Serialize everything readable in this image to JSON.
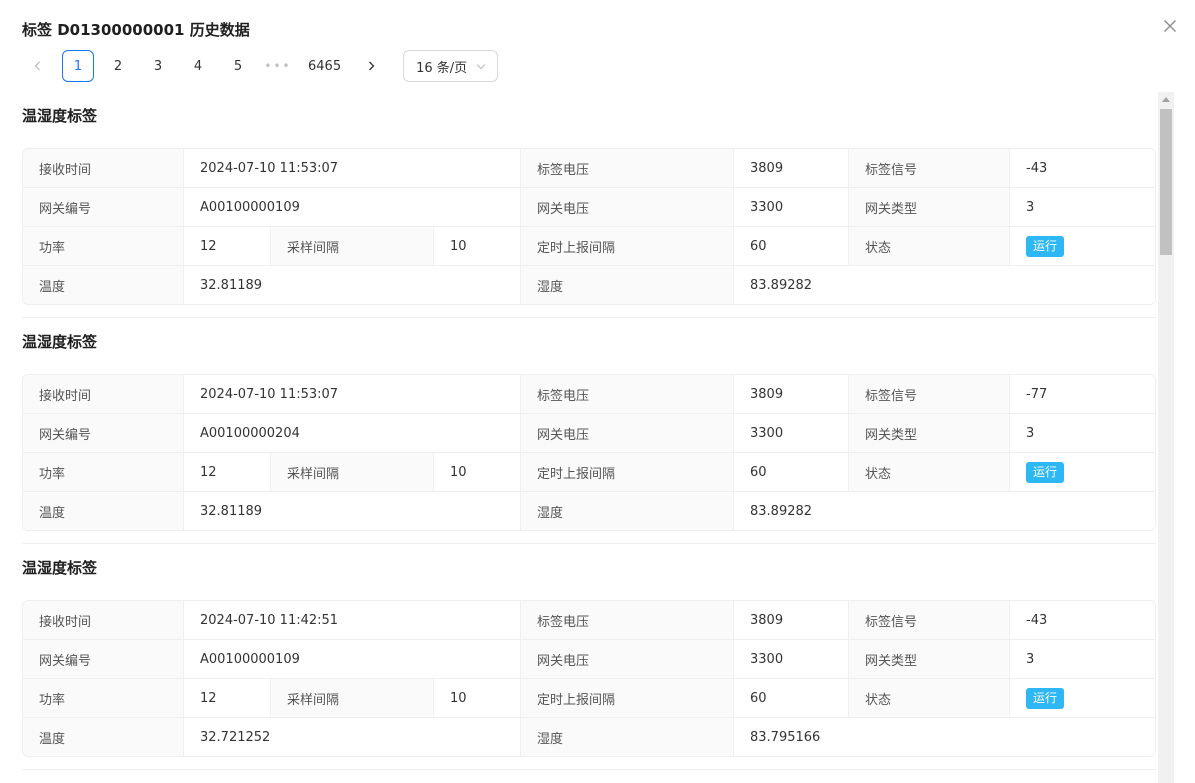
{
  "modal": {
    "title": "标签 D01300000001 历史数据",
    "close_icon": "close-icon"
  },
  "pagination": {
    "pages": [
      "1",
      "2",
      "3",
      "4",
      "5"
    ],
    "ellipsis": "•••",
    "last_page": "6465",
    "current": "1",
    "page_size_label": "16 条/页",
    "prev_icon": "chevron-left-icon",
    "next_icon": "chevron-right-icon",
    "select_icon": "chevron-down-icon"
  },
  "labels": {
    "receive_time": "接收时间",
    "tag_voltage": "标签电压",
    "tag_signal": "标签信号",
    "gateway_id": "网关编号",
    "gateway_voltage": "网关电压",
    "gateway_type": "网关类型",
    "power": "功率",
    "sample_interval": "采样间隔",
    "report_interval": "定时上报间隔",
    "status": "状态",
    "temperature": "温度",
    "humidity": "湿度"
  },
  "records": [
    {
      "title": "温湿度标签",
      "receive_time": "2024-07-10 11:53:07",
      "tag_voltage": "3809",
      "tag_signal": "-43",
      "gateway_id": "A00100000109",
      "gateway_voltage": "3300",
      "gateway_type": "3",
      "power": "12",
      "sample_interval": "10",
      "report_interval": "60",
      "status": "运行",
      "temperature": "32.81189",
      "humidity": "83.89282"
    },
    {
      "title": "温湿度标签",
      "receive_time": "2024-07-10 11:53:07",
      "tag_voltage": "3809",
      "tag_signal": "-77",
      "gateway_id": "A00100000204",
      "gateway_voltage": "3300",
      "gateway_type": "3",
      "power": "12",
      "sample_interval": "10",
      "report_interval": "60",
      "status": "运行",
      "temperature": "32.81189",
      "humidity": "83.89282"
    },
    {
      "title": "温湿度标签",
      "receive_time": "2024-07-10 11:42:51",
      "tag_voltage": "3809",
      "tag_signal": "-43",
      "gateway_id": "A00100000109",
      "gateway_voltage": "3300",
      "gateway_type": "3",
      "power": "12",
      "sample_interval": "10",
      "report_interval": "60",
      "status": "运行",
      "temperature": "32.721252",
      "humidity": "83.795166"
    }
  ],
  "colors": {
    "primary": "#1677ff",
    "status_badge": "#2db7f5",
    "label_bg": "#fafafa",
    "border": "#efefef"
  }
}
